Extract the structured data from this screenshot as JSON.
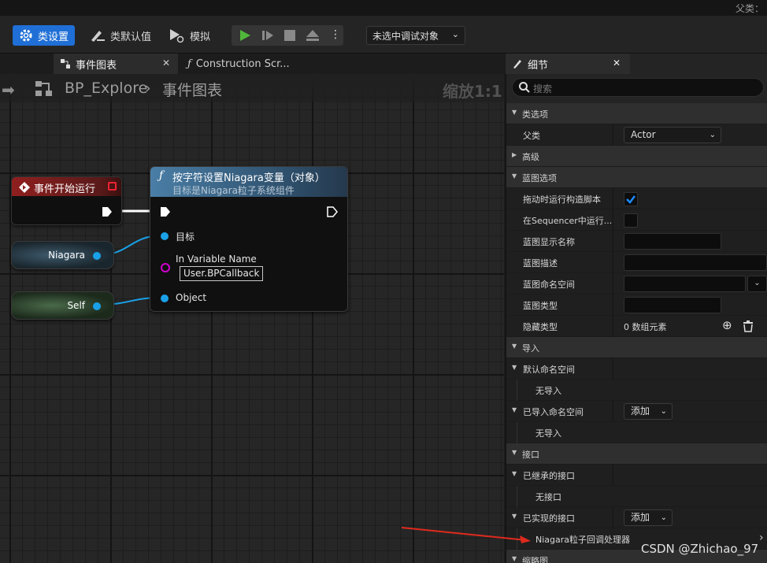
{
  "titlebar": {
    "parent_class_label": "父类："
  },
  "toolbar": {
    "class_settings": "类设置",
    "class_defaults": "类默认值",
    "simulate": "模拟",
    "debug_object": "未选中调试对象"
  },
  "graph_tabs": {
    "event_graph": "事件图表",
    "construction_script": "Construction Scr..."
  },
  "breadcrumb": {
    "blueprint": "BP_Explore",
    "graph": "事件图表",
    "zoom": "缩放1:1"
  },
  "nodes": {
    "event_begin": {
      "title": "事件开始运行"
    },
    "set_var": {
      "title": "按字符设置Niagara变量（对象）",
      "subtitle": "目标是Niagara粒子系统组件",
      "pin_target": "目标",
      "pin_varname": "In Variable Name",
      "varname_value": "User.BPCallback",
      "pin_object": "Object"
    },
    "niagara_var": {
      "label": "Niagara"
    },
    "self_var": {
      "label": "Self"
    }
  },
  "details": {
    "tab": "细节",
    "search_placeholder": "搜索",
    "rows": {
      "class_options": "类选项",
      "parent_class": "父类",
      "parent_class_value": "Actor",
      "advanced": "高级",
      "blueprint_options": "蓝图选项",
      "run_construction": "拖动时运行构造脚本",
      "run_in_sequencer": "在Sequencer中运行...",
      "bp_display_name": "蓝图显示名称",
      "bp_description": "蓝图描述",
      "bp_namespace": "蓝图命名空间",
      "bp_type": "蓝图类型",
      "hide_categories": "隐藏类型",
      "hide_categories_value": "0 数组元素",
      "imports": "导入",
      "default_namespaces": "默认命名空间",
      "no_imports_1": "无导入",
      "imported_namespaces": "已导入命名空间",
      "add_1": "添加",
      "no_imports_2": "无导入",
      "interfaces": "接口",
      "inherited_interfaces": "已继承的接口",
      "no_interfaces": "无接口",
      "implemented_interfaces": "已实现的接口",
      "add_2": "添加",
      "niagara_callback": "Niagara粒子回调处理器",
      "thumbnail": "缩略图"
    }
  },
  "watermark": "CSDN @Zhichao_97",
  "colors": {
    "accent_blue": "#1f6fd6",
    "event_red": "#8f1f1f",
    "function_blue": "#4a7ea6",
    "object_pin": "#1aa0e8",
    "name_pin": "#d000d0",
    "annotation_arrow": "#e02a1e"
  }
}
